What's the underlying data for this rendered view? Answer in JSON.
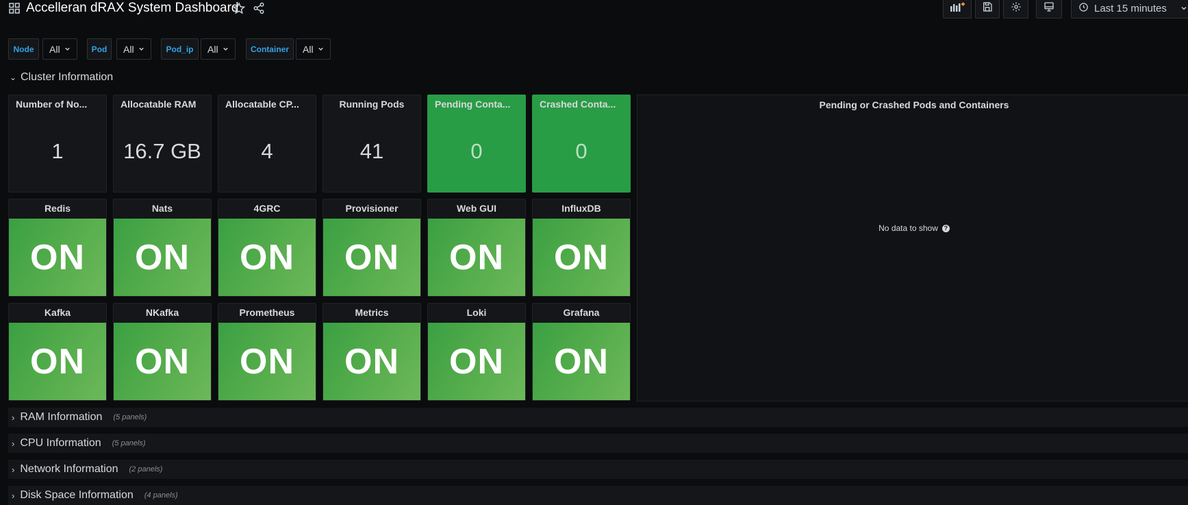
{
  "header": {
    "title": "Accelleran dRAX System Dashboard",
    "time_range": "Last 15 minutes",
    "icons": [
      "apps-icon",
      "star-icon",
      "share-icon",
      "add-panel-icon",
      "save-icon",
      "settings-icon",
      "tv-mode-icon",
      "clock-icon"
    ]
  },
  "variables": [
    {
      "label": "Node",
      "value": "All"
    },
    {
      "label": "Pod",
      "value": "All"
    },
    {
      "label": "Pod_ip",
      "value": "All"
    },
    {
      "label": "Container",
      "value": "All"
    }
  ],
  "cluster_row": {
    "title": "Cluster Information"
  },
  "stats": [
    {
      "title": "Number of No...",
      "value": "1"
    },
    {
      "title": "Allocatable RAM",
      "value": "16.7 GB"
    },
    {
      "title": "Allocatable CP...",
      "value": "4"
    },
    {
      "title": "Running Pods",
      "value": "41"
    },
    {
      "title": "Pending Conta...",
      "value": "0"
    },
    {
      "title": "Crashed Conta...",
      "value": "0"
    }
  ],
  "services_row1": [
    {
      "title": "Redis",
      "status": "ON"
    },
    {
      "title": "Nats",
      "status": "ON"
    },
    {
      "title": "4GRC",
      "status": "ON"
    },
    {
      "title": "Provisioner",
      "status": "ON"
    },
    {
      "title": "Web GUI",
      "status": "ON"
    },
    {
      "title": "InfluxDB",
      "status": "ON"
    }
  ],
  "services_row2": [
    {
      "title": "Kafka",
      "status": "ON"
    },
    {
      "title": "NKafka",
      "status": "ON"
    },
    {
      "title": "Prometheus",
      "status": "ON"
    },
    {
      "title": "Metrics",
      "status": "ON"
    },
    {
      "title": "Loki",
      "status": "ON"
    },
    {
      "title": "Grafana",
      "status": "ON"
    }
  ],
  "pending_panel": {
    "title": "Pending or Crashed Pods and Containers",
    "empty_text": "No data to show"
  },
  "collapsed_rows": [
    {
      "title": "RAM Information",
      "count": "(5 panels)"
    },
    {
      "title": "CPU Information",
      "count": "(5 panels)"
    },
    {
      "title": "Network Information",
      "count": "(2 panels)"
    },
    {
      "title": "Disk Space Information",
      "count": "(4 panels)"
    }
  ],
  "colors": {
    "background": "#0b0c0e",
    "panel": "#141619",
    "green": "#299c46",
    "service_green": "#52ab4a",
    "variable_label": "#33a2e5"
  }
}
